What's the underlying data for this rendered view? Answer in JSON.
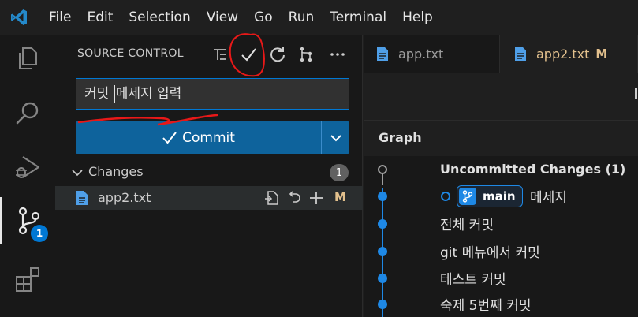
{
  "menu": [
    "File",
    "Edit",
    "Selection",
    "View",
    "Go",
    "Run",
    "Terminal",
    "Help"
  ],
  "activity_bar": {
    "items": [
      "explorer-icon",
      "search-icon",
      "run-debug-icon",
      "source-control-icon",
      "extensions-icon"
    ],
    "source_control_badge": "1"
  },
  "sidebar": {
    "title": "SOURCE CONTROL",
    "message_before_caret": "커밋 ",
    "message_after_caret": "메세지 입력",
    "commit_label": "Commit",
    "changes_label": "Changes",
    "changes_count": "1",
    "files": [
      {
        "name": "app2.txt",
        "status": "M"
      }
    ]
  },
  "tabs": [
    {
      "label": "app.txt",
      "status": ""
    },
    {
      "label": "app2.txt",
      "status": "M"
    }
  ],
  "graph": {
    "title": "Graph",
    "uncommitted": "Uncommitted Changes (1)",
    "branch": "main",
    "commits": [
      "메세지",
      "전체 커밋",
      "git 메뉴에서 커밋",
      "테스트 커밋",
      "숙제 5번째 커밋"
    ]
  },
  "colors": {
    "accent": "#0078d4",
    "commit_button": "#0e639c",
    "modified": "#e2c08d",
    "graph_line": "#1e88e5",
    "annotation": "#e81818"
  }
}
